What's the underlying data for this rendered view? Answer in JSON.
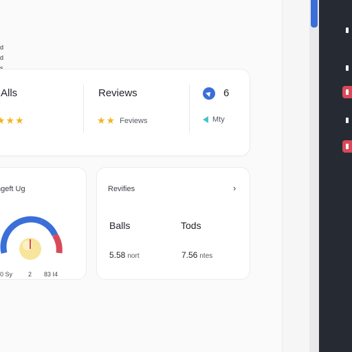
{
  "top_snippet": [
    "d",
    "d",
    "s"
  ],
  "summary": {
    "stats": [
      {
        "title": "Alls",
        "stars": "★★★",
        "sub": ""
      },
      {
        "title": "Reviews",
        "stars": "★★",
        "sub": "Feviews"
      },
      {
        "title": "6",
        "stars": "",
        "sub": "Mty"
      }
    ]
  },
  "gauge_card": {
    "title": "ngeft Ug",
    "level": 0.62,
    "labels": [
      "0 Sy",
      "2",
      "83 I4"
    ],
    "colors": {
      "blue": "#3b6fd8",
      "red": "#d9495a",
      "knob": "#f6e59a"
    }
  },
  "reviews_card": {
    "title": "Revifies",
    "columns": [
      {
        "head": "Balls",
        "value": "5.58",
        "unit": "nort"
      },
      {
        "head": "Tods",
        "value": "7.56",
        "unit": "ntes"
      }
    ]
  },
  "rail_items": [
    "nav-1",
    "nav-2",
    "nav-3",
    "nav-4",
    "nav-5"
  ],
  "accent": {
    "blue": "#3b6fd8",
    "star": "#f2b51f",
    "rail": "#262a33",
    "rail_red": "#d9495a"
  }
}
